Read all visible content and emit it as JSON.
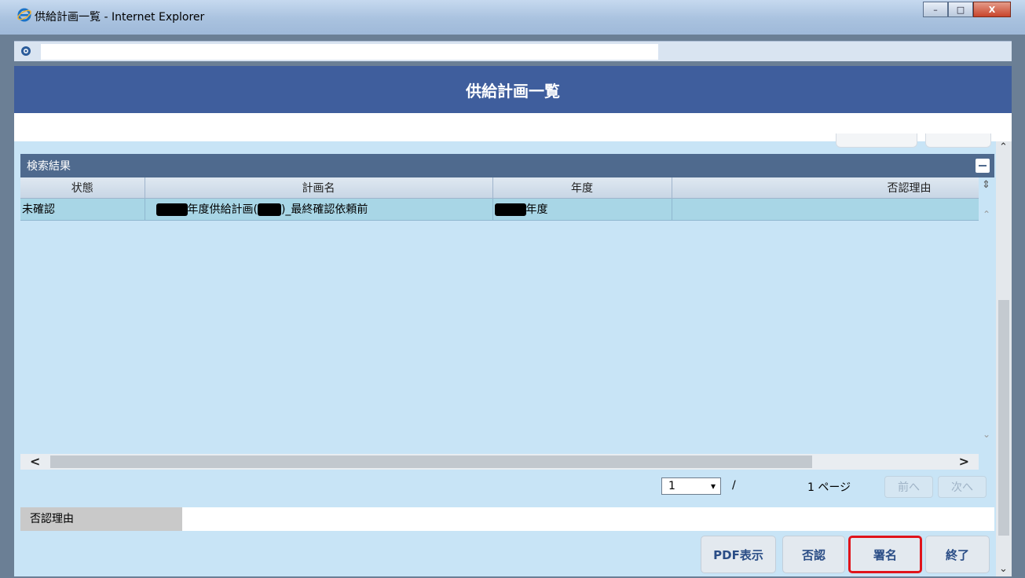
{
  "window": {
    "title": "供給計画一覧 - Internet Explorer",
    "minimize_label": "–",
    "maximize_label": "□",
    "close_label": "X"
  },
  "address": {
    "url": ""
  },
  "page": {
    "header": "供給計画一覧"
  },
  "results": {
    "section_title": "検索結果",
    "columns": [
      "状態",
      "計画名",
      "年度",
      "否認理由"
    ],
    "rows": [
      {
        "status": "未確認",
        "plan_name_part1": "年度供給計画(",
        "plan_name_part2": ")_最終確認依頼前",
        "year_suffix": "年度",
        "reject_reason": ""
      }
    ]
  },
  "pager": {
    "current_page": "1",
    "slash": "/",
    "total_pages": "1 ページ",
    "prev_label": "前へ",
    "next_label": "次へ"
  },
  "reason": {
    "label": "否認理由",
    "value": ""
  },
  "actions": {
    "pdf_label": "PDF表示",
    "reject_label": "否認",
    "sign_label": "署名",
    "exit_label": "終了"
  },
  "colors": {
    "header_bg": "#3f5e9d",
    "section_bg": "#4f6a8e",
    "row_bg": "#a8d6e6",
    "highlight_border": "#e0141b"
  }
}
